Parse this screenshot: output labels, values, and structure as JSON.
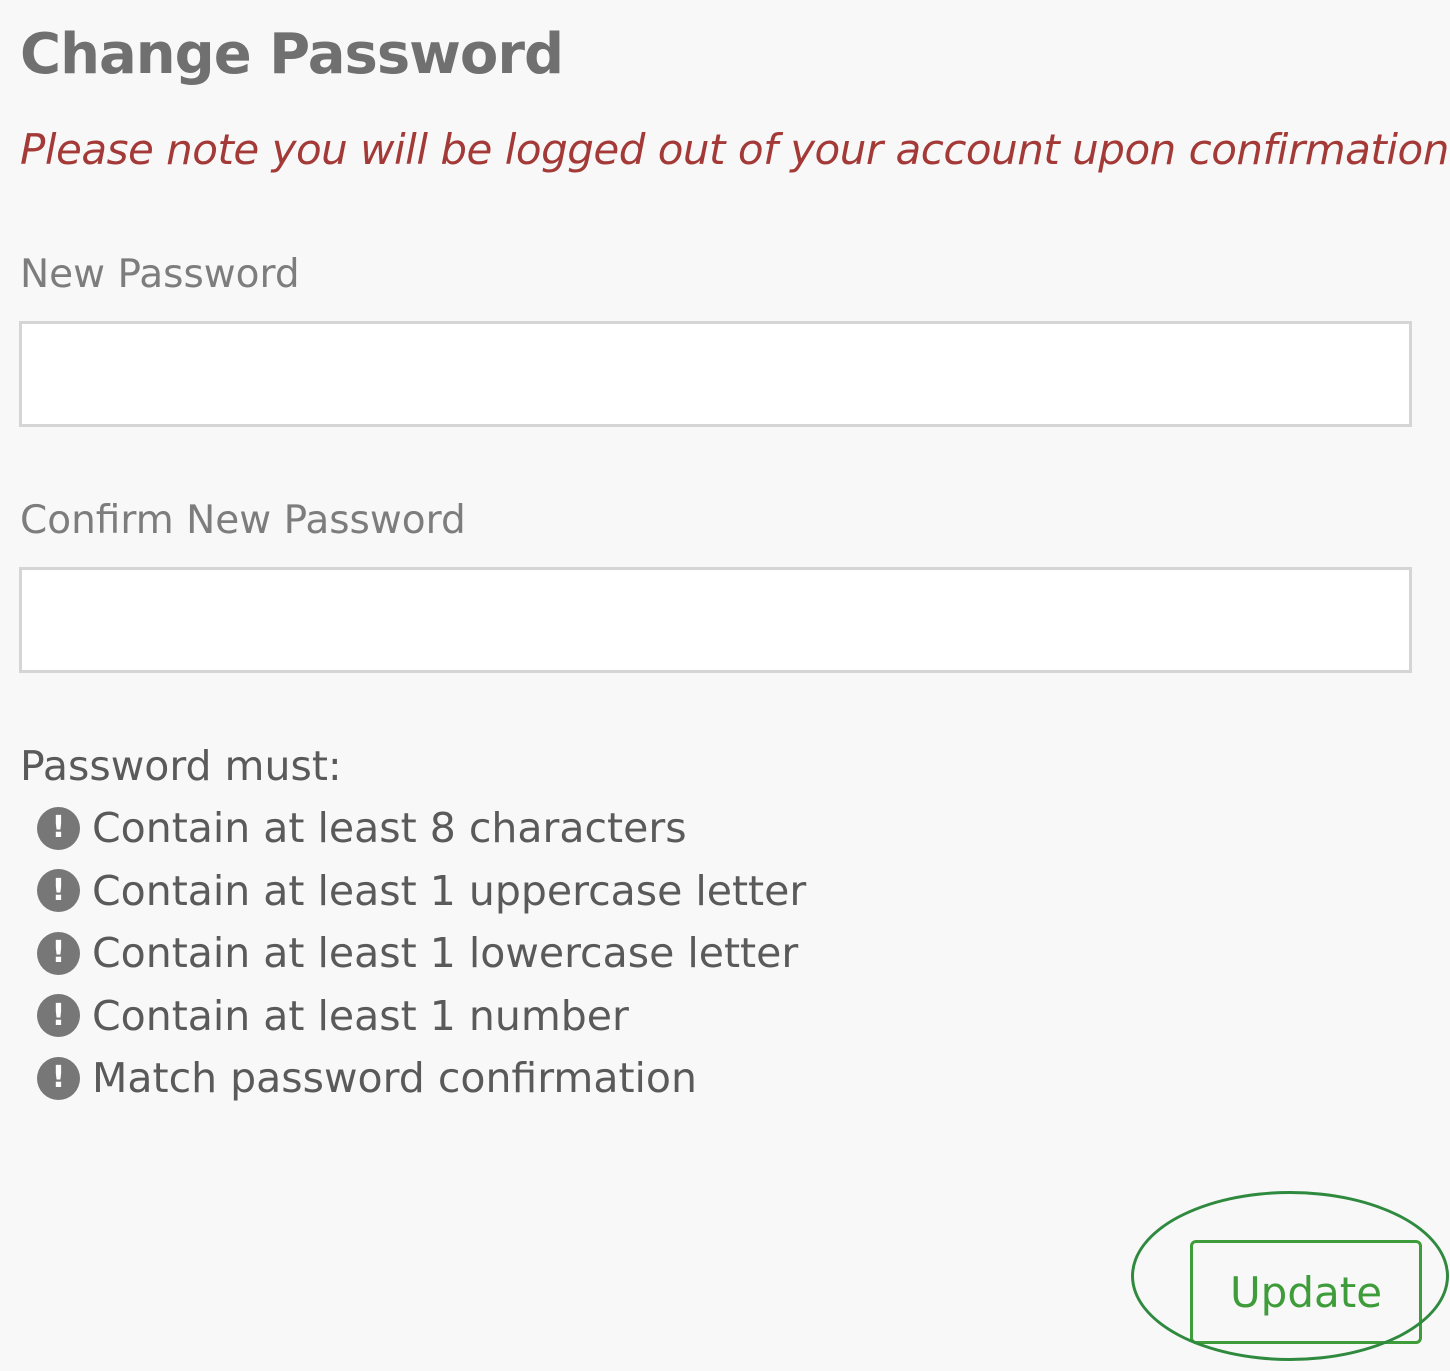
{
  "page": {
    "title": "Change Password",
    "notice": "Please note you will be logged out of your account upon confirmation"
  },
  "form": {
    "new_password": {
      "label": "New Password",
      "value": "",
      "placeholder": ""
    },
    "confirm_password": {
      "label": "Confirm New Password",
      "value": "",
      "placeholder": ""
    }
  },
  "requirements": {
    "heading": "Password must:",
    "items": [
      {
        "icon": "exclamation-circle-icon",
        "glyph": "!",
        "text": "Contain at least 8 characters"
      },
      {
        "icon": "exclamation-circle-icon",
        "glyph": "!",
        "text": "Contain at least 1 uppercase letter"
      },
      {
        "icon": "exclamation-circle-icon",
        "glyph": "!",
        "text": "Contain at least 1 lowercase letter"
      },
      {
        "icon": "exclamation-circle-icon",
        "glyph": "!",
        "text": "Contain at least 1 number"
      },
      {
        "icon": "exclamation-circle-icon",
        "glyph": "!",
        "text": "Match password confirmation"
      }
    ]
  },
  "actions": {
    "update_label": "Update"
  },
  "colors": {
    "background": "#f8f8f8",
    "title": "#707070",
    "notice": "#a33a37",
    "label": "#7d7d7d",
    "body_text": "#5a5a5a",
    "icon": "#777777",
    "accent_green": "#3f9c3a",
    "highlight_ring": "#2f8a3f"
  }
}
